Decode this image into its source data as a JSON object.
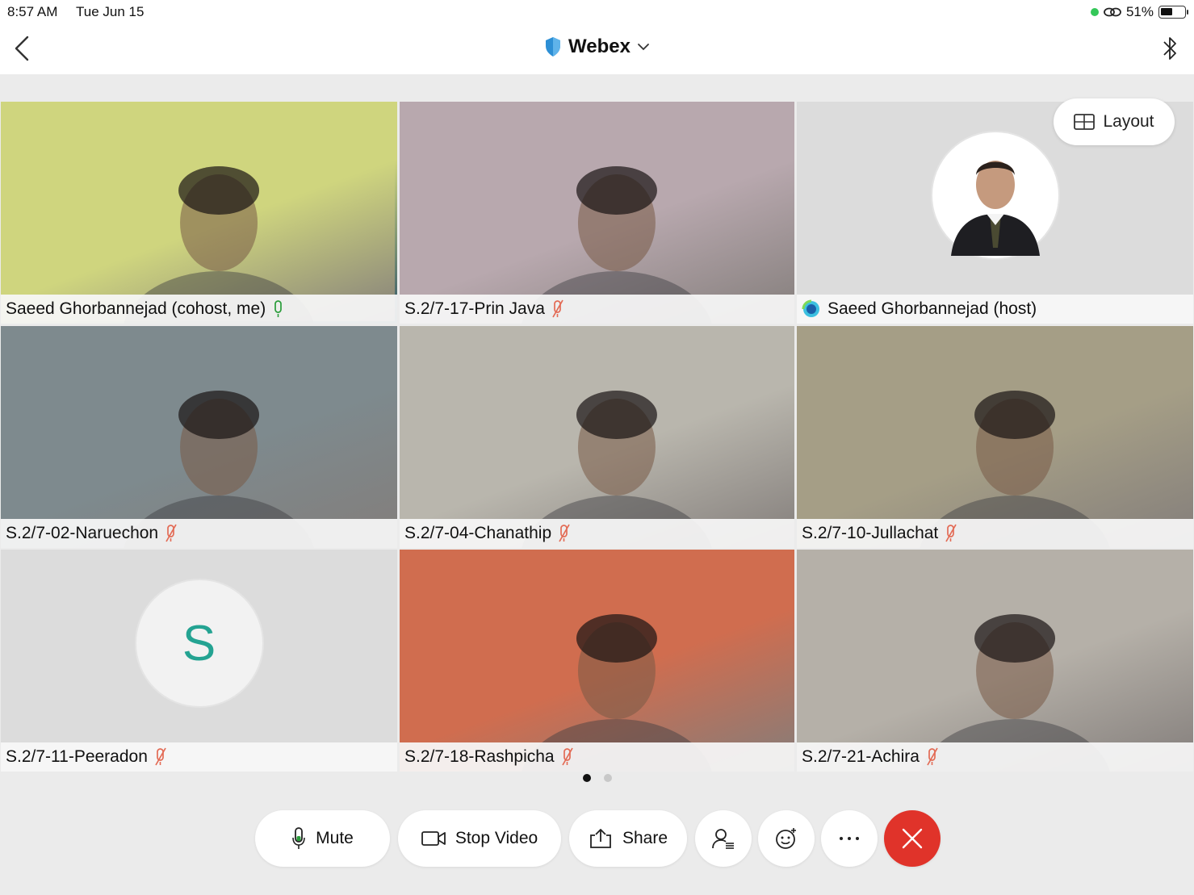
{
  "status_bar": {
    "time": "8:57 AM",
    "date": "Tue Jun 15",
    "battery": "51%"
  },
  "header": {
    "title": "Webex"
  },
  "layout_button": {
    "label": "Layout"
  },
  "participants": [
    {
      "name": "Saeed Ghorbannejad (cohost, me)",
      "mic": "on",
      "type": "video",
      "bg": "#cfd57e"
    },
    {
      "name": "S.2/7-17-Prin Java",
      "mic": "muted",
      "type": "video",
      "bg": "#b8a8ae"
    },
    {
      "name": "Saeed Ghorbannejad (host)",
      "mic": "none",
      "type": "photo",
      "bg": "#dcdcdc"
    },
    {
      "name": "S.2/7-02-Naruechon",
      "mic": "muted",
      "type": "video",
      "bg": "#7e8a8e"
    },
    {
      "name": "S.2/7-04-Chanathip",
      "mic": "muted",
      "type": "video",
      "bg": "#b9b6ad"
    },
    {
      "name": "S.2/7-10-Jullachat",
      "mic": "muted",
      "type": "video",
      "bg": "#a59e86"
    },
    {
      "name": "S.2/7-11-Peeradon",
      "mic": "muted",
      "type": "initial",
      "initial": "S",
      "bg": "#dcdcdc"
    },
    {
      "name": "S.2/7-18-Rashpicha",
      "mic": "muted",
      "type": "video",
      "bg": "#d06d4f"
    },
    {
      "name": "S.2/7-21-Achira",
      "mic": "muted",
      "type": "video",
      "bg": "#b5b0a8"
    }
  ],
  "pager": {
    "pages": 2,
    "current": 1
  },
  "controls": {
    "mute_label": "Mute",
    "stop_video_label": "Stop Video",
    "share_label": "Share"
  },
  "colors": {
    "active_border": "#1a7ab3",
    "mic_on": "#2a9d3a",
    "mic_muted": "#e36b55",
    "end_call": "#e0332a"
  }
}
